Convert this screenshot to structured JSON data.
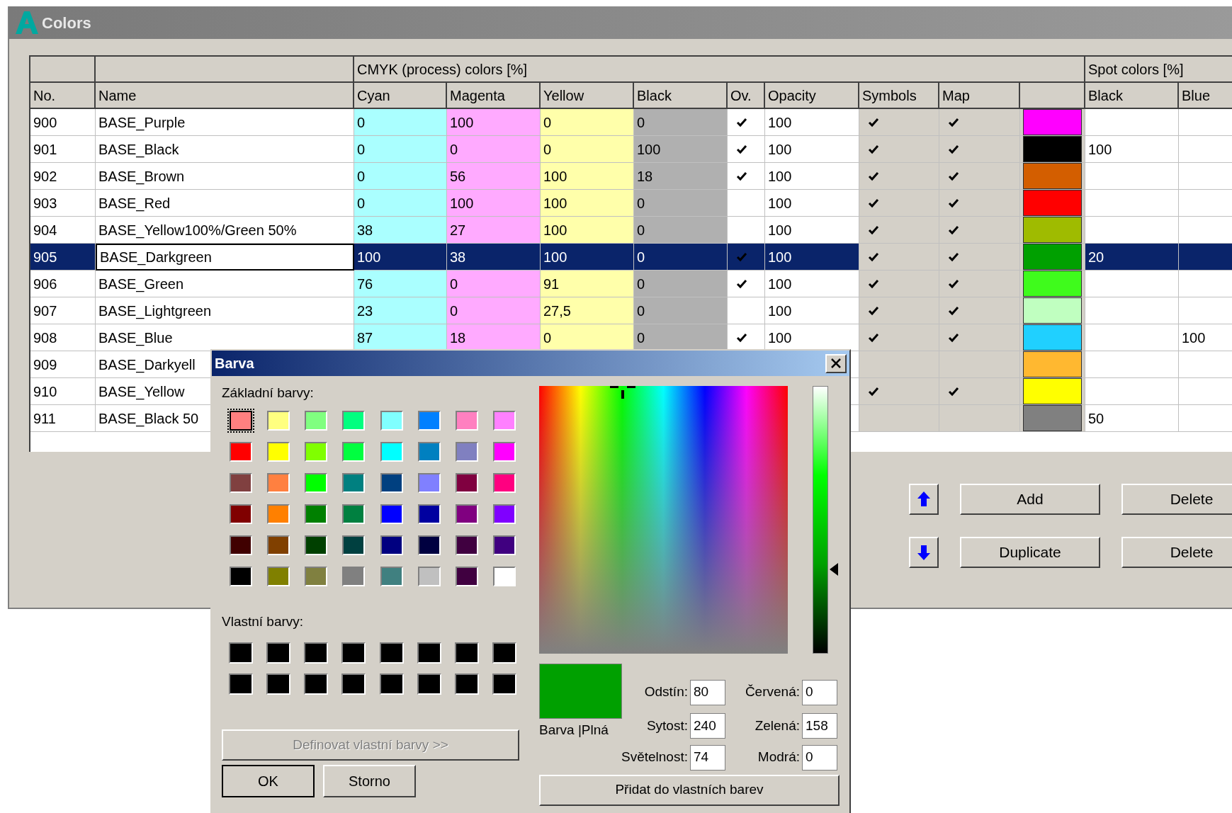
{
  "window": {
    "title": "Colors"
  },
  "table": {
    "group_headers": [
      "CMYK (process) colors [%]",
      "Spot colors [%]"
    ],
    "columns": [
      "No.",
      "Name",
      "Cyan",
      "Magenta",
      "Yellow",
      "Black",
      "Ov.",
      "Opacity",
      "Symbols",
      "Map",
      "Black",
      "Blue"
    ],
    "rows": [
      {
        "no": "900",
        "name": "BASE_Purple",
        "cyan": "0",
        "magenta": "100",
        "yellow": "0",
        "black": "0",
        "ov": true,
        "opacity": "100",
        "symbols": true,
        "map": true,
        "color": "#ff00ff",
        "selected": false
      },
      {
        "no": "901",
        "name": "BASE_Black",
        "cyan": "0",
        "magenta": "0",
        "yellow": "0",
        "black": "100",
        "ov": true,
        "opacity": "100",
        "symbols": true,
        "map": true,
        "color": "#000000",
        "spot_black": "100",
        "selected": false
      },
      {
        "no": "902",
        "name": "BASE_Brown",
        "cyan": "0",
        "magenta": "56",
        "yellow": "100",
        "black": "18",
        "ov": true,
        "opacity": "100",
        "symbols": true,
        "map": true,
        "color": "#d35e00",
        "selected": false
      },
      {
        "no": "903",
        "name": "BASE_Red",
        "cyan": "0",
        "magenta": "100",
        "yellow": "100",
        "black": "0",
        "ov": false,
        "opacity": "100",
        "symbols": true,
        "map": true,
        "color": "#ff0000",
        "selected": false
      },
      {
        "no": "904",
        "name": "BASE_Yellow100%/Green 50%",
        "cyan": "38",
        "magenta": "27",
        "yellow": "100",
        "black": "0",
        "ov": false,
        "opacity": "100",
        "symbols": true,
        "map": true,
        "color": "#9fbb00",
        "selected": false
      },
      {
        "no": "905",
        "name": "BASE_Darkgreen",
        "cyan": "100",
        "magenta": "38",
        "yellow": "100",
        "black": "0",
        "ov": true,
        "opacity": "100",
        "symbols": true,
        "map": true,
        "color": "#00a000",
        "spot_black": "20",
        "selected": true
      },
      {
        "no": "906",
        "name": "BASE_Green",
        "cyan": "76",
        "magenta": "0",
        "yellow": "91",
        "black": "0",
        "ov": true,
        "opacity": "100",
        "symbols": true,
        "map": true,
        "color": "#3ffb1c",
        "selected": false
      },
      {
        "no": "907",
        "name": "BASE_Lightgreen",
        "cyan": "23",
        "magenta": "0",
        "yellow": "27,5",
        "black": "0",
        "ov": false,
        "opacity": "100",
        "symbols": true,
        "map": true,
        "color": "#c0ffc0",
        "selected": false
      },
      {
        "no": "908",
        "name": "BASE_Blue",
        "cyan": "87",
        "magenta": "18",
        "yellow": "0",
        "black": "0",
        "ov": true,
        "opacity": "100",
        "symbols": true,
        "map": true,
        "color": "#20d0ff",
        "spot_blue": "100",
        "selected": false
      },
      {
        "no": "909",
        "name": "BASE_Darkyell",
        "symbols": false,
        "map": false,
        "color": "#ffb830",
        "selected": false
      },
      {
        "no": "910",
        "name": "BASE_Yellow",
        "symbols": true,
        "map": true,
        "color": "#ffff00",
        "selected": false
      },
      {
        "no": "911",
        "name": "BASE_Black 50",
        "symbols": false,
        "map": false,
        "color": "#808080",
        "spot_black": "50",
        "selected": false
      }
    ]
  },
  "side_buttons": [
    [
      {
        "kind": "arrow_up"
      },
      {
        "kind": "text",
        "label": "Add"
      },
      {
        "kind": "text",
        "label": "Delete"
      }
    ],
    [
      {
        "kind": "arrow_down"
      },
      {
        "kind": "text",
        "label": "Duplicate"
      },
      {
        "kind": "text",
        "label": "Delete"
      }
    ]
  ],
  "dialog": {
    "title": "Barva",
    "basic_label": "Základní barvy:",
    "basic_colors": [
      {
        "color": "#ff8080",
        "selected": true
      },
      {
        "color": "#ffff80",
        "selected": false
      },
      {
        "color": "#80ff80",
        "selected": false
      },
      {
        "color": "#00ff80",
        "selected": false
      },
      {
        "color": "#80ffff",
        "selected": false
      },
      {
        "color": "#0080ff",
        "selected": false
      },
      {
        "color": "#ff80c0",
        "selected": false
      },
      {
        "color": "#ff80ff",
        "selected": false
      },
      {
        "color": "#ff0000",
        "selected": false
      },
      {
        "color": "#ffff00",
        "selected": false
      },
      {
        "color": "#80ff00",
        "selected": false
      },
      {
        "color": "#00ff40",
        "selected": false
      },
      {
        "color": "#00ffff",
        "selected": false
      },
      {
        "color": "#0080c0",
        "selected": false
      },
      {
        "color": "#8080c0",
        "selected": false
      },
      {
        "color": "#ff00ff",
        "selected": false
      },
      {
        "color": "#804040",
        "selected": false
      },
      {
        "color": "#ff8040",
        "selected": false
      },
      {
        "color": "#00ff00",
        "selected": false
      },
      {
        "color": "#008080",
        "selected": false
      },
      {
        "color": "#004080",
        "selected": false
      },
      {
        "color": "#8080ff",
        "selected": false
      },
      {
        "color": "#800040",
        "selected": false
      },
      {
        "color": "#ff0080",
        "selected": false
      },
      {
        "color": "#800000",
        "selected": false
      },
      {
        "color": "#ff8000",
        "selected": false
      },
      {
        "color": "#008000",
        "selected": false
      },
      {
        "color": "#008040",
        "selected": false
      },
      {
        "color": "#0000ff",
        "selected": false
      },
      {
        "color": "#0000a0",
        "selected": false
      },
      {
        "color": "#800080",
        "selected": false
      },
      {
        "color": "#8000ff",
        "selected": false
      },
      {
        "color": "#400000",
        "selected": false
      },
      {
        "color": "#804000",
        "selected": false
      },
      {
        "color": "#004000",
        "selected": false
      },
      {
        "color": "#004040",
        "selected": false
      },
      {
        "color": "#000080",
        "selected": false
      },
      {
        "color": "#000040",
        "selected": false
      },
      {
        "color": "#400040",
        "selected": false
      },
      {
        "color": "#400080",
        "selected": false
      },
      {
        "color": "#000000",
        "selected": false
      },
      {
        "color": "#808000",
        "selected": false
      },
      {
        "color": "#808040",
        "selected": false
      },
      {
        "color": "#808080",
        "selected": false
      },
      {
        "color": "#408080",
        "selected": false
      },
      {
        "color": "#c0c0c0",
        "selected": false
      },
      {
        "color": "#400040",
        "selected": false
      },
      {
        "color": "#ffffff",
        "selected": false
      }
    ],
    "custom_label": "Vlastní barvy:",
    "custom_colors": [
      {
        "color": "#000000"
      },
      {
        "color": "#000000"
      },
      {
        "color": "#000000"
      },
      {
        "color": "#000000"
      },
      {
        "color": "#000000"
      },
      {
        "color": "#000000"
      },
      {
        "color": "#000000"
      },
      {
        "color": "#000000"
      },
      {
        "color": "#000000"
      },
      {
        "color": "#000000"
      },
      {
        "color": "#000000"
      },
      {
        "color": "#000000"
      },
      {
        "color": "#000000"
      },
      {
        "color": "#000000"
      },
      {
        "color": "#000000"
      },
      {
        "color": "#000000"
      }
    ],
    "define_button": {
      "label": "Definovat vlastní barvy >>",
      "disabled": true
    },
    "ok_button": "OK",
    "cancel_button": "Storno",
    "preview": {
      "label": "Barva |Plná",
      "color": "#00a000"
    },
    "fields": [
      {
        "label": "Odstín:",
        "value": "80"
      },
      {
        "label": "Červená:",
        "value": "0"
      },
      {
        "label": "Sytost:",
        "value": "240"
      },
      {
        "label": "Zelená:",
        "value": "158"
      },
      {
        "label": "Světelnost:",
        "value": "74"
      },
      {
        "label": "Modrá:",
        "value": "0"
      }
    ],
    "add_button": "Přidat do vlastních barev"
  }
}
